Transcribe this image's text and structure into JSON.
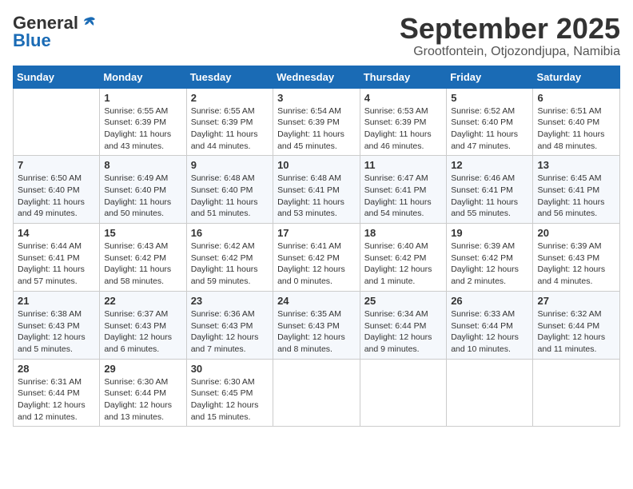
{
  "logo": {
    "general": "General",
    "blue": "Blue"
  },
  "header": {
    "month": "September 2025",
    "location": "Grootfontein, Otjozondjupa, Namibia"
  },
  "weekdays": [
    "Sunday",
    "Monday",
    "Tuesday",
    "Wednesday",
    "Thursday",
    "Friday",
    "Saturday"
  ],
  "weeks": [
    [
      {
        "day": "",
        "info": ""
      },
      {
        "day": "1",
        "info": "Sunrise: 6:55 AM\nSunset: 6:39 PM\nDaylight: 11 hours\nand 43 minutes."
      },
      {
        "day": "2",
        "info": "Sunrise: 6:55 AM\nSunset: 6:39 PM\nDaylight: 11 hours\nand 44 minutes."
      },
      {
        "day": "3",
        "info": "Sunrise: 6:54 AM\nSunset: 6:39 PM\nDaylight: 11 hours\nand 45 minutes."
      },
      {
        "day": "4",
        "info": "Sunrise: 6:53 AM\nSunset: 6:39 PM\nDaylight: 11 hours\nand 46 minutes."
      },
      {
        "day": "5",
        "info": "Sunrise: 6:52 AM\nSunset: 6:40 PM\nDaylight: 11 hours\nand 47 minutes."
      },
      {
        "day": "6",
        "info": "Sunrise: 6:51 AM\nSunset: 6:40 PM\nDaylight: 11 hours\nand 48 minutes."
      }
    ],
    [
      {
        "day": "7",
        "info": "Sunrise: 6:50 AM\nSunset: 6:40 PM\nDaylight: 11 hours\nand 49 minutes."
      },
      {
        "day": "8",
        "info": "Sunrise: 6:49 AM\nSunset: 6:40 PM\nDaylight: 11 hours\nand 50 minutes."
      },
      {
        "day": "9",
        "info": "Sunrise: 6:48 AM\nSunset: 6:40 PM\nDaylight: 11 hours\nand 51 minutes."
      },
      {
        "day": "10",
        "info": "Sunrise: 6:48 AM\nSunset: 6:41 PM\nDaylight: 11 hours\nand 53 minutes."
      },
      {
        "day": "11",
        "info": "Sunrise: 6:47 AM\nSunset: 6:41 PM\nDaylight: 11 hours\nand 54 minutes."
      },
      {
        "day": "12",
        "info": "Sunrise: 6:46 AM\nSunset: 6:41 PM\nDaylight: 11 hours\nand 55 minutes."
      },
      {
        "day": "13",
        "info": "Sunrise: 6:45 AM\nSunset: 6:41 PM\nDaylight: 11 hours\nand 56 minutes."
      }
    ],
    [
      {
        "day": "14",
        "info": "Sunrise: 6:44 AM\nSunset: 6:41 PM\nDaylight: 11 hours\nand 57 minutes."
      },
      {
        "day": "15",
        "info": "Sunrise: 6:43 AM\nSunset: 6:42 PM\nDaylight: 11 hours\nand 58 minutes."
      },
      {
        "day": "16",
        "info": "Sunrise: 6:42 AM\nSunset: 6:42 PM\nDaylight: 11 hours\nand 59 minutes."
      },
      {
        "day": "17",
        "info": "Sunrise: 6:41 AM\nSunset: 6:42 PM\nDaylight: 12 hours\nand 0 minutes."
      },
      {
        "day": "18",
        "info": "Sunrise: 6:40 AM\nSunset: 6:42 PM\nDaylight: 12 hours\nand 1 minute."
      },
      {
        "day": "19",
        "info": "Sunrise: 6:39 AM\nSunset: 6:42 PM\nDaylight: 12 hours\nand 2 minutes."
      },
      {
        "day": "20",
        "info": "Sunrise: 6:39 AM\nSunset: 6:43 PM\nDaylight: 12 hours\nand 4 minutes."
      }
    ],
    [
      {
        "day": "21",
        "info": "Sunrise: 6:38 AM\nSunset: 6:43 PM\nDaylight: 12 hours\nand 5 minutes."
      },
      {
        "day": "22",
        "info": "Sunrise: 6:37 AM\nSunset: 6:43 PM\nDaylight: 12 hours\nand 6 minutes."
      },
      {
        "day": "23",
        "info": "Sunrise: 6:36 AM\nSunset: 6:43 PM\nDaylight: 12 hours\nand 7 minutes."
      },
      {
        "day": "24",
        "info": "Sunrise: 6:35 AM\nSunset: 6:43 PM\nDaylight: 12 hours\nand 8 minutes."
      },
      {
        "day": "25",
        "info": "Sunrise: 6:34 AM\nSunset: 6:44 PM\nDaylight: 12 hours\nand 9 minutes."
      },
      {
        "day": "26",
        "info": "Sunrise: 6:33 AM\nSunset: 6:44 PM\nDaylight: 12 hours\nand 10 minutes."
      },
      {
        "day": "27",
        "info": "Sunrise: 6:32 AM\nSunset: 6:44 PM\nDaylight: 12 hours\nand 11 minutes."
      }
    ],
    [
      {
        "day": "28",
        "info": "Sunrise: 6:31 AM\nSunset: 6:44 PM\nDaylight: 12 hours\nand 12 minutes."
      },
      {
        "day": "29",
        "info": "Sunrise: 6:30 AM\nSunset: 6:44 PM\nDaylight: 12 hours\nand 13 minutes."
      },
      {
        "day": "30",
        "info": "Sunrise: 6:30 AM\nSunset: 6:45 PM\nDaylight: 12 hours\nand 15 minutes."
      },
      {
        "day": "",
        "info": ""
      },
      {
        "day": "",
        "info": ""
      },
      {
        "day": "",
        "info": ""
      },
      {
        "day": "",
        "info": ""
      }
    ]
  ]
}
